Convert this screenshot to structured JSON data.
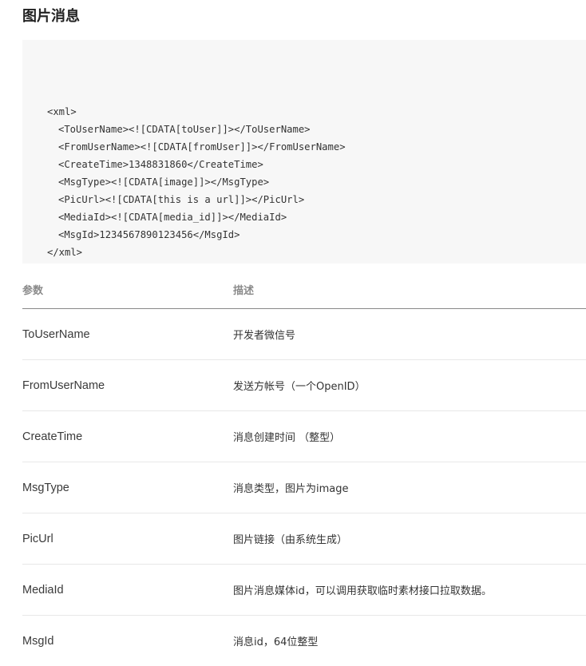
{
  "title": "图片消息",
  "code": {
    "lines": [
      "<xml>",
      "<ToUserName><![CDATA[toUser]]></ToUserName>",
      "<FromUserName><![CDATA[fromUser]]></FromUserName>",
      "<CreateTime>1348831860</CreateTime>",
      "<MsgType><![CDATA[image]]></MsgType>",
      "<PicUrl><![CDATA[this is a url]]></PicUrl>",
      "<MediaId><![CDATA[media_id]]></MediaId>",
      "<MsgId>1234567890123456</MsgId>",
      "</xml>"
    ]
  },
  "table": {
    "headers": {
      "param": "参数",
      "desc": "描述"
    },
    "rows": [
      {
        "param": "ToUserName",
        "desc": "开发者微信号"
      },
      {
        "param": "FromUserName",
        "desc": "发送方帐号（一个OpenID）"
      },
      {
        "param": "CreateTime",
        "desc": "消息创建时间 （整型）"
      },
      {
        "param": "MsgType",
        "desc": "消息类型，图片为image"
      },
      {
        "param": "PicUrl",
        "desc": "图片链接（由系统生成）"
      },
      {
        "param": "MediaId",
        "desc": "图片消息媒体id，可以调用获取临时素材接口拉取数据。"
      },
      {
        "param": "MsgId",
        "desc": "消息id，64位整型"
      }
    ]
  },
  "colors": {
    "code_background": "#f7f7f7",
    "header_text": "#8a8a8a",
    "header_rule": "#888888",
    "row_rule": "#e8e8e8"
  }
}
